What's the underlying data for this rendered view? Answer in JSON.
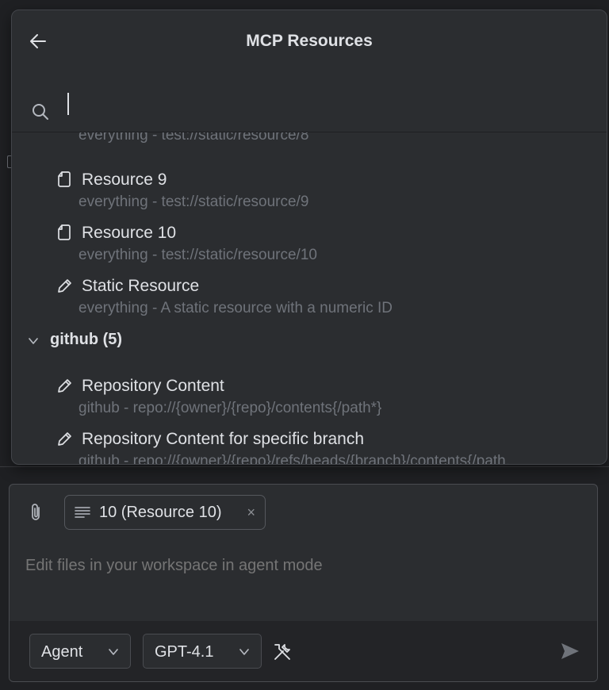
{
  "popup": {
    "title": "MCP Resources",
    "back_icon": "arrow-left-icon",
    "search": {
      "placeholder": "",
      "value": "",
      "icon": "search-icon"
    }
  },
  "resources": {
    "partial_desc": "everything - test://static/resource/8",
    "items": [
      {
        "icon": "file-icon",
        "name": "Resource 9",
        "desc": "everything - test://static/resource/9"
      },
      {
        "icon": "file-icon",
        "name": "Resource 10",
        "desc": "everything - test://static/resource/10"
      },
      {
        "icon": "pencil-icon",
        "name": "Static Resource",
        "desc": "everything - A static resource with a numeric ID"
      }
    ],
    "group": {
      "label": "github (5)",
      "items": [
        {
          "icon": "pencil-icon",
          "name": "Repository Content",
          "desc": "github - repo://{owner}/{repo}/contents{/path*}"
        },
        {
          "icon": "pencil-icon",
          "name": "Repository Content for specific branch",
          "desc": "github - repo://{owner}/{repo}/refs/heads/{branch}/contents{/path."
        }
      ]
    }
  },
  "chat": {
    "attach_icon": "paperclip-icon",
    "chip": {
      "label": "10 (Resource 10)",
      "close": "×",
      "icon": "lines-icon"
    },
    "prompt_placeholder": "Edit files in your workspace in agent mode",
    "mode": {
      "value": "Agent"
    },
    "model": {
      "value": "GPT-4.1"
    },
    "tools_icon": "tools-icon",
    "send_icon": "send-icon"
  },
  "colors": {
    "background": "#1f2023",
    "panel": "#2b2d30",
    "text": "#dfe1e5",
    "muted": "#6f737a"
  }
}
